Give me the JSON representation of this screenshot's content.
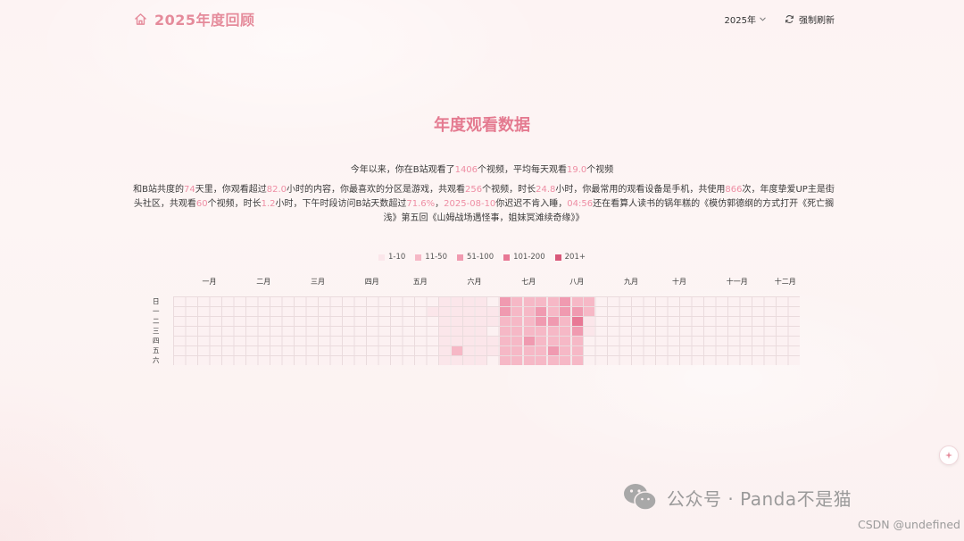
{
  "header": {
    "title": "2025年度回顾",
    "year_label": "2025年",
    "refresh_label": "强制刷新",
    "accent_color": "#e58b9b"
  },
  "section": {
    "title": "年度观看数据"
  },
  "summary": {
    "p1": "今年以来，你在B站观看了",
    "v1": "1406",
    "p2": "个视频，平均每天观看",
    "v2": "19.0",
    "p3": "个视频"
  },
  "detail": {
    "t1": "和B站共度的",
    "v1": "74",
    "t2": "天里，你观看超过",
    "v2": "82.0",
    "t3": "小时的内容，你最喜欢的分区是游戏，共观看",
    "v3": "256",
    "t4": "个视频，时长",
    "v4": "24.8",
    "t5": "小时，你最常用的观看设备是手机，共使用",
    "v5": "866",
    "t6": "次，年度挚爱UP主是街头社区，共观看",
    "v6": "60",
    "t7": "个视频，时长",
    "v7": "1.2",
    "t8": "小时，下午时段访问B站天数超过",
    "v8": "71.6%",
    "t9": "，",
    "v9": "2025-08-10",
    "t10": "你迟迟不肯入睡，",
    "v10": "04:56",
    "t11": "还在看算人读书的锅年糕的《模仿郭德纲的方式打开《死亡搁浅》第五回《山姆战场遇怪事，姐妹冥滩续奇缘》》"
  },
  "legend": [
    {
      "label": "1-10",
      "color": "#fbe6ea"
    },
    {
      "label": "11-50",
      "color": "#f6b8c6"
    },
    {
      "label": "51-100",
      "color": "#f09ab0"
    },
    {
      "label": "101-200",
      "color": "#e87895"
    },
    {
      "label": "201+",
      "color": "#d9587a"
    }
  ],
  "heatmap": {
    "months": [
      "一月",
      "二月",
      "三月",
      "四月",
      "五月",
      "六月",
      "七月",
      "八月",
      "九月",
      "十月",
      "十一月",
      "十二月"
    ],
    "days": [
      "日",
      "一",
      "二",
      "三",
      "四",
      "五",
      "六"
    ],
    "weeks_shown": 52,
    "activity": [
      {
        "week": 21,
        "levels": [
          0,
          1,
          0,
          0,
          0,
          0,
          0
        ]
      },
      {
        "week": 22,
        "levels": [
          1,
          1,
          1,
          1,
          1,
          1,
          1
        ]
      },
      {
        "week": 23,
        "levels": [
          1,
          1,
          1,
          1,
          1,
          2,
          1
        ]
      },
      {
        "week": 24,
        "levels": [
          1,
          1,
          1,
          1,
          1,
          1,
          1
        ]
      },
      {
        "week": 25,
        "levels": [
          1,
          1,
          1,
          1,
          1,
          1,
          1
        ]
      },
      {
        "week": 26,
        "levels": [
          0,
          1,
          1,
          0,
          1,
          1,
          0
        ]
      },
      {
        "week": 27,
        "levels": [
          3,
          3,
          2,
          2,
          2,
          2,
          2
        ]
      },
      {
        "week": 28,
        "levels": [
          2,
          2,
          2,
          2,
          2,
          2,
          2
        ]
      },
      {
        "week": 29,
        "levels": [
          2,
          2,
          2,
          2,
          3,
          2,
          2
        ]
      },
      {
        "week": 30,
        "levels": [
          2,
          3,
          3,
          2,
          2,
          2,
          2
        ]
      },
      {
        "week": 31,
        "levels": [
          2,
          2,
          3,
          2,
          2,
          3,
          2
        ]
      },
      {
        "week": 32,
        "levels": [
          3,
          3,
          2,
          2,
          2,
          2,
          2
        ]
      },
      {
        "week": 33,
        "levels": [
          2,
          3,
          4,
          3,
          2,
          2,
          2
        ]
      },
      {
        "week": 34,
        "levels": [
          2,
          2,
          1,
          1,
          0,
          0,
          0
        ]
      }
    ]
  },
  "watermark": {
    "text": "公众号 · Panda不是猫",
    "csdn": "CSDN @undefined"
  }
}
